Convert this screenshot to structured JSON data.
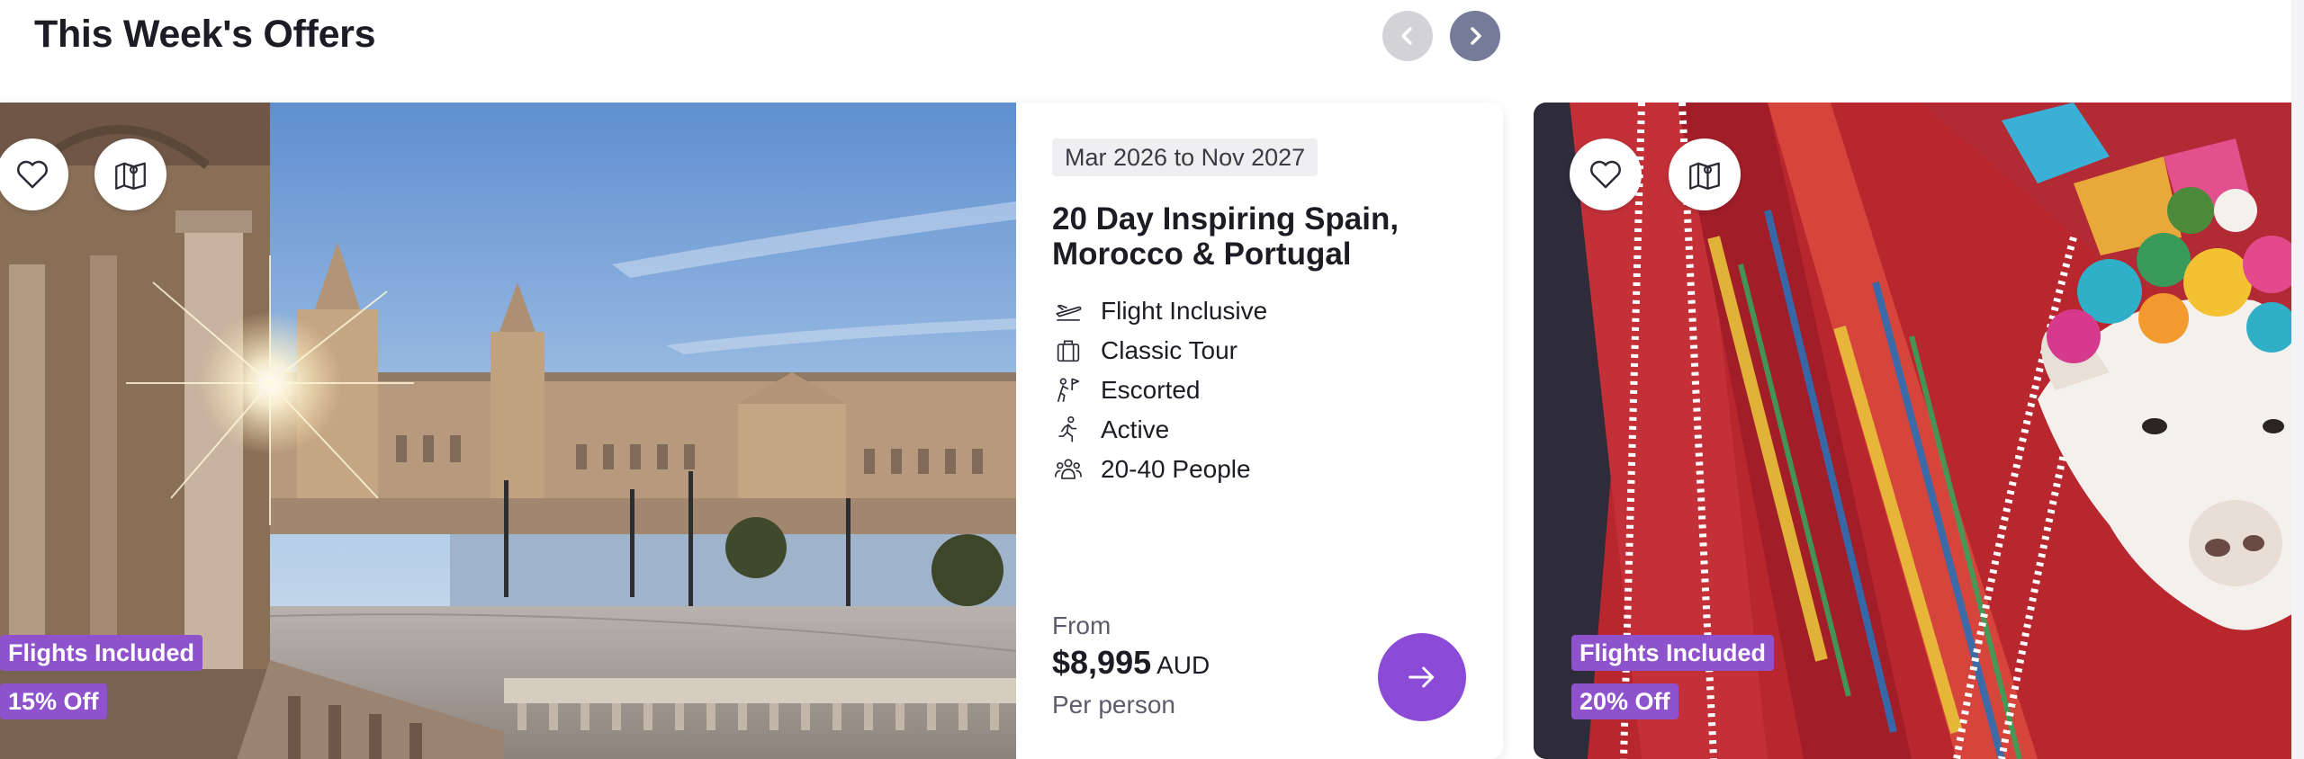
{
  "header": {
    "title": "This Week's Offers",
    "close_icon": "close-icon",
    "prev_icon": "chevron-left-icon",
    "next_icon": "chevron-right-icon"
  },
  "offers": [
    {
      "favorite_icon": "heart-icon",
      "map_icon": "map-icon",
      "badges": [
        "Flights Included",
        "15% Off"
      ],
      "dates": "Mar 2026 to Nov 2027",
      "name": "20 Day Inspiring Spain, Morocco & Portugal",
      "features": [
        {
          "icon": "plane-icon",
          "label": "Flight Inclusive"
        },
        {
          "icon": "suitcase-icon",
          "label": "Classic Tour"
        },
        {
          "icon": "guide-flag-icon",
          "label": "Escorted"
        },
        {
          "icon": "running-icon",
          "label": "Active"
        },
        {
          "icon": "group-icon",
          "label": "20-40 People"
        }
      ],
      "price": {
        "from_label": "From",
        "amount": "$8,995",
        "currency": "AUD",
        "per_label": "Per person"
      },
      "go_icon": "arrow-right-icon"
    },
    {
      "favorite_icon": "heart-icon",
      "map_icon": "map-icon",
      "badges": [
        "Flights Included",
        "20% Off"
      ]
    }
  ],
  "colors": {
    "accent": "#8b4bd6",
    "badge": "#8e52cc",
    "nav_active": "#747c99",
    "nav_disabled": "#d3d3d7"
  }
}
